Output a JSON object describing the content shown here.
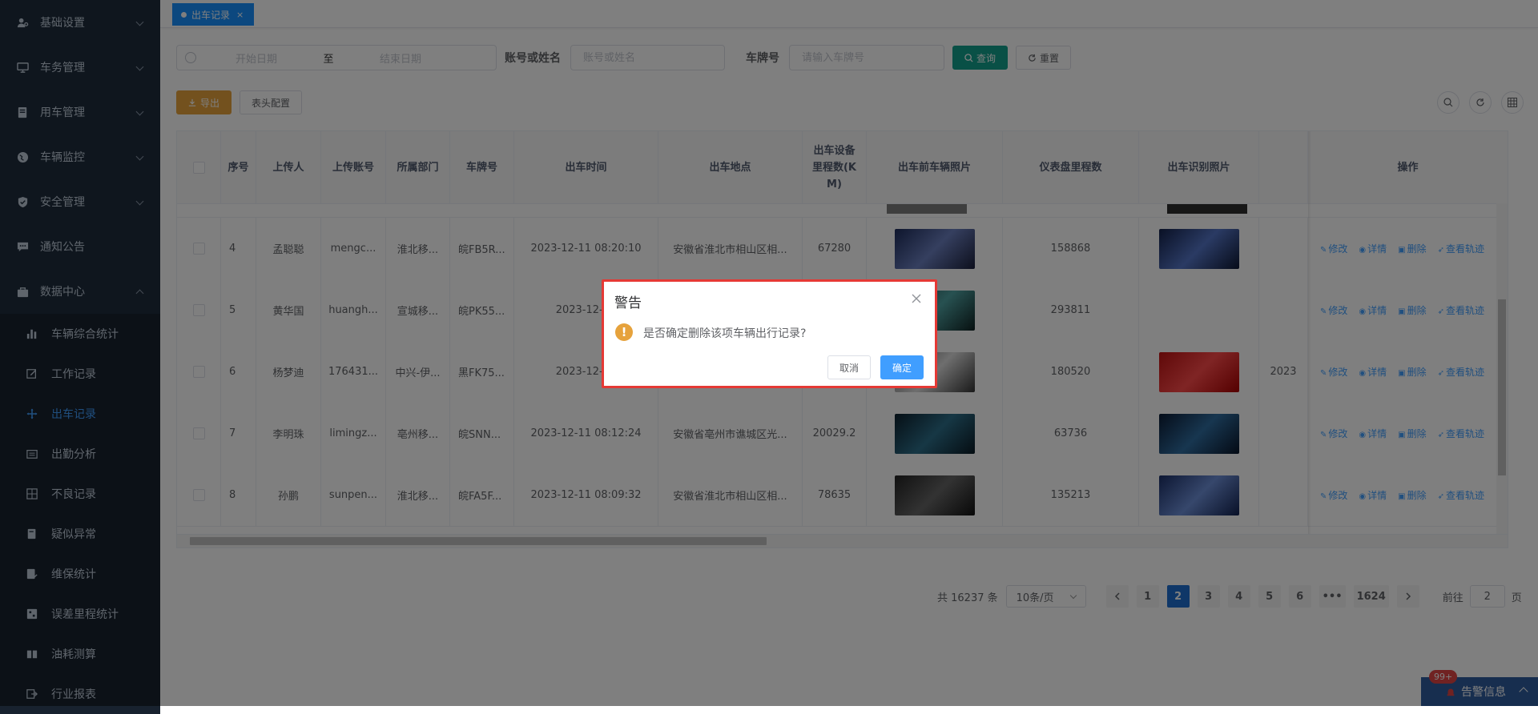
{
  "sidebar": {
    "menus": [
      {
        "label": "基础设置",
        "icon": "user-gear-icon"
      },
      {
        "label": "车务管理",
        "icon": "monitor-icon"
      },
      {
        "label": "用车管理",
        "icon": "car-doc-icon"
      },
      {
        "label": "车辆监控",
        "icon": "globe-icon"
      },
      {
        "label": "安全管理",
        "icon": "shield-icon"
      },
      {
        "label": "通知公告",
        "icon": "chat-icon"
      },
      {
        "label": "数据中心",
        "icon": "bag-icon"
      }
    ],
    "submenu": [
      {
        "label": "车辆综合统计",
        "icon": "bar-chart-icon"
      },
      {
        "label": "工作记录",
        "icon": "edit-icon"
      },
      {
        "label": "出车记录",
        "icon": "move-icon"
      },
      {
        "label": "出勤分析",
        "icon": "calendar-icon"
      },
      {
        "label": "不良记录",
        "icon": "grid-icon"
      },
      {
        "label": "疑似异常",
        "icon": "book-icon"
      },
      {
        "label": "维保统计",
        "icon": "doc-check-icon"
      },
      {
        "label": "误差里程统计",
        "icon": "doc-grid-icon"
      },
      {
        "label": "油耗测算",
        "icon": "book-open-icon"
      },
      {
        "label": "行业报表",
        "icon": "export-icon"
      }
    ]
  },
  "tags": {
    "active": "出车记录",
    "close": "×"
  },
  "search": {
    "start_placeholder": "开始日期",
    "range_sep": "至",
    "end_placeholder": "结束日期",
    "account_label": "账号或姓名",
    "account_placeholder": "账号或姓名",
    "plate_label": "车牌号",
    "plate_placeholder": "请输入车牌号",
    "query": "查询",
    "reset": "重置"
  },
  "toolbar": {
    "export": "导出",
    "header_config": "表头配置"
  },
  "table": {
    "headers": [
      "序号",
      "上传人",
      "上传账号",
      "所属部门",
      "车牌号",
      "出车时间",
      "出车地点",
      "出车设备里程数(KM)",
      "出车前车辆照片",
      "仪表盘里程数",
      "出车识别照片",
      "操作"
    ],
    "rows": [
      {
        "no": "4",
        "uploader": "孟聪聪",
        "account": "mengc...",
        "dept": "淮北移...",
        "plate": "皖FB5R...",
        "time": "2023-12-11 08:20:10",
        "place": "安徽省淮北市相山区相...",
        "device_km": "67280",
        "dash_km": "158868",
        "extra": ""
      },
      {
        "no": "5",
        "uploader": "黄华国",
        "account": "huangh...",
        "dept": "宣城移...",
        "plate": "皖PK55...",
        "time": "2023-12-11",
        "place": "",
        "device_km": "",
        "dash_km": "293811",
        "extra": ""
      },
      {
        "no": "6",
        "uploader": "杨梦迪",
        "account": "176431...",
        "dept": "中兴-伊...",
        "plate": "黑FK75...",
        "time": "2023-12-11",
        "place": "",
        "device_km": "",
        "dash_km": "180520",
        "extra": "2023"
      },
      {
        "no": "7",
        "uploader": "李明珠",
        "account": "limingz...",
        "dept": "亳州移...",
        "plate": "皖SNN...",
        "time": "2023-12-11 08:12:24",
        "place": "安徽省亳州市谯城区光...",
        "device_km": "20029.2",
        "dash_km": "63736",
        "extra": ""
      },
      {
        "no": "8",
        "uploader": "孙鹏",
        "account": "sunpen...",
        "dept": "淮北移...",
        "plate": "皖FA5F...",
        "time": "2023-12-11 08:09:32",
        "place": "安徽省淮北市相山区相...",
        "device_km": "78635",
        "dash_km": "135213",
        "extra": ""
      }
    ],
    "ops": [
      "修改",
      "详情",
      "删除",
      "查看轨迹"
    ]
  },
  "pagination": {
    "total": "共 16237 条",
    "page_size": "10条/页",
    "pages": [
      "1",
      "2",
      "3",
      "4",
      "5",
      "6",
      "•••",
      "1624"
    ],
    "current": "2",
    "goto_label": "前往",
    "goto_value": "2",
    "goto_unit": "页"
  },
  "alarm": {
    "badge": "99+",
    "label": "告警信息"
  },
  "dialog": {
    "title": "警告",
    "message": "是否确定删除该项车辆出行记录?",
    "icon_char": "!",
    "cancel": "取消",
    "confirm": "确定"
  }
}
